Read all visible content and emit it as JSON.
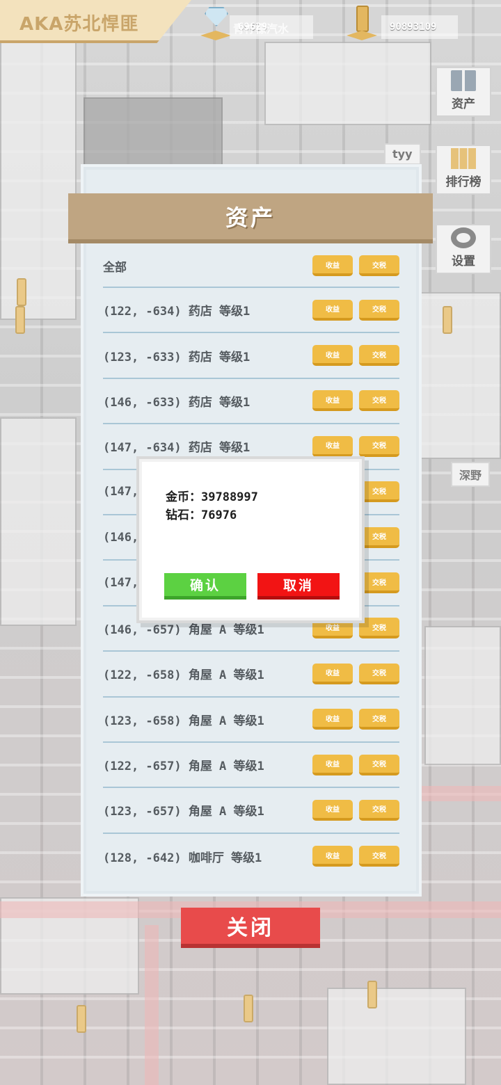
{
  "top": {
    "player_name": "AKA苏北悍匪",
    "diamonds": "69629",
    "coins": "90893109",
    "overhead_label": "青柠檬汽水"
  },
  "side_menu": [
    {
      "label": "资产",
      "icon": "assets-icon"
    },
    {
      "label": "排行榜",
      "icon": "leaderboard-icon"
    },
    {
      "label": "设置",
      "icon": "gear-icon"
    }
  ],
  "map_labels": [
    "tyy",
    "深野"
  ],
  "panel": {
    "title": "资产",
    "collect_label": "收益",
    "tax_label": "交税",
    "rows": [
      "全部",
      "(122, -634) 药店 等级1",
      "(123, -633) 药店 等级1",
      "(146, -633) 药店 等级1",
      "(147, -634) 药店 等级1",
      "(147,",
      "(146,",
      "(147,",
      "(146, -657) 角屋 A 等级1",
      "(122, -658) 角屋 A 等级1",
      "(123, -658) 角屋 A 等级1",
      "(122, -657) 角屋 A 等级1",
      "(123, -657) 角屋 A 等级1",
      "(128, -642) 咖啡厅 等级1"
    ]
  },
  "close_label": "关闭",
  "dialog": {
    "coins_line": "金币：39788997",
    "diamonds_line": "钻石：76976",
    "confirm_label": "确认",
    "cancel_label": "取消"
  },
  "colors": {
    "panel_header": "#bfa582",
    "pill": "#f0bc45",
    "close": "#e84b4b",
    "confirm": "#5cd142",
    "cancel": "#f21414"
  }
}
